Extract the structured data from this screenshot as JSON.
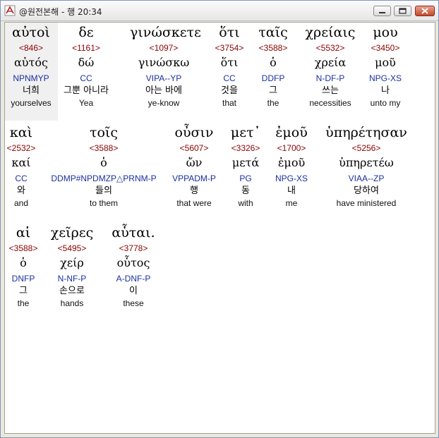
{
  "window": {
    "title": "@원전본해 - 행 20:34",
    "minimize": "–",
    "maximize": "□",
    "close": "✕"
  },
  "rows": [
    {
      "words": [
        {
          "greek": "αὐτοὶ",
          "strong": "<846>",
          "lemma": "αὐτός",
          "parse": "NPNMYP",
          "korean": "너희",
          "english": "yourselves"
        },
        {
          "greek": "δε",
          "strong": "<1161>",
          "lemma": "δώ",
          "parse": "CC",
          "korean": "그뿐 아니라",
          "english": "Yea"
        },
        {
          "greek": "γινώσκετε",
          "strong": "<1097>",
          "lemma": "γινώσκω",
          "parse": "VIPA--YP",
          "korean": "아는 바에",
          "english": "ye-know"
        },
        {
          "greek": "ὅτι",
          "strong": "<3754>",
          "lemma": "ὅτι",
          "parse": "CC",
          "korean": "것을",
          "english": "that"
        },
        {
          "greek": "ταῖς",
          "strong": "<3588>",
          "lemma": "ὁ",
          "parse": "DDFP",
          "korean": "그",
          "english": "the"
        },
        {
          "greek": "χρείαις",
          "strong": "<5532>",
          "lemma": "χρεία",
          "parse": "N-DF-P",
          "korean": "쓰는",
          "english": "necessities"
        },
        {
          "greek": "μου",
          "strong": "<3450>",
          "lemma": "μοῦ",
          "parse": "NPG-XS",
          "korean": "나",
          "english": "unto my"
        }
      ]
    },
    {
      "words": [
        {
          "greek": "καὶ",
          "strong": "<2532>",
          "lemma": "καί",
          "parse": "CC",
          "korean": "와",
          "english": "and"
        },
        {
          "greek": "τοῖς",
          "strong": "<3588>",
          "lemma": "ὁ",
          "parse": "DDMP#NPDMZP△PRNM-P",
          "korean": "들의",
          "english": "to them"
        },
        {
          "greek": "οὖσιν",
          "strong": "<5607>",
          "lemma": "ὤν",
          "parse": "VPPADM-P",
          "korean": "행",
          "english": "that were"
        },
        {
          "greek": "μετ᾽",
          "strong": "<3326>",
          "lemma": "μετά",
          "parse": "PG",
          "korean": "동",
          "english": "with"
        },
        {
          "greek": "ἐμοῦ",
          "strong": "<1700>",
          "lemma": "ἐμοῦ",
          "parse": "NPG-XS",
          "korean": "내",
          "english": "me"
        },
        {
          "greek": "ὑπηρέτησαν",
          "strong": "<5256>",
          "lemma": "ὑπηρετέω",
          "parse": "VIAA--ZP",
          "korean": "당하여",
          "english": "have ministered"
        }
      ]
    },
    {
      "words": [
        {
          "greek": "αἱ",
          "strong": "<3588>",
          "lemma": "ὁ",
          "parse": "DNFP",
          "korean": "그",
          "english": "the"
        },
        {
          "greek": "χεῖρες",
          "strong": "<5495>",
          "lemma": "χείρ",
          "parse": "N-NF-P",
          "korean": "손으로",
          "english": "hands"
        },
        {
          "greek": "αὗται.",
          "strong": "<3778>",
          "lemma": "οὗτος",
          "parse": "A-DNF-P",
          "korean": "이",
          "english": "these"
        }
      ]
    }
  ]
}
